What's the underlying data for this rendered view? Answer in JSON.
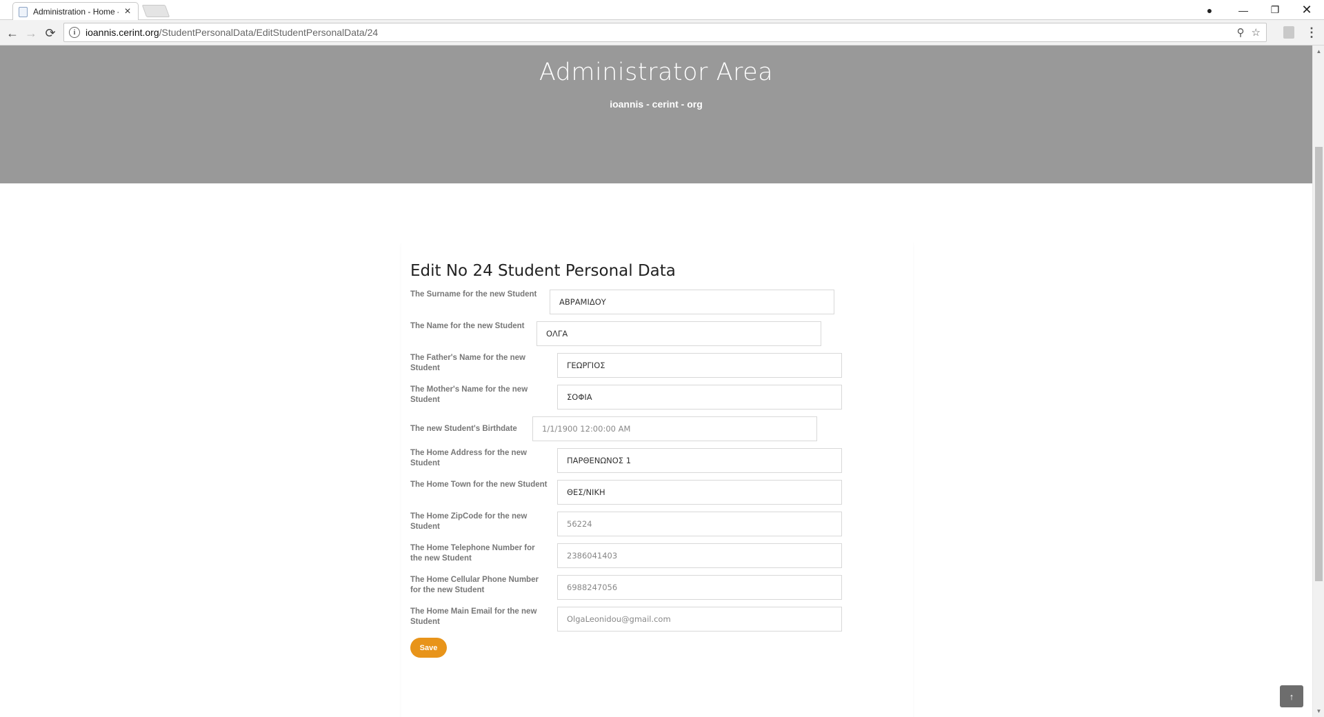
{
  "browser": {
    "tab_title": "Administration - Home -",
    "tab_close": "×",
    "url_host": "ioannis.cerint.org",
    "url_path": "/StudentPersonalData/EditStudentPersonalData/24",
    "info_icon": "i",
    "back_icon": "←",
    "forward_icon": "→",
    "reload_icon": "⟳",
    "zoom_icon": "⚲",
    "star_icon": "☆",
    "menu_icon": "⋮",
    "user_icon": "●",
    "minimize_icon": "—",
    "maximize_icon": "❐",
    "close_icon": "✕"
  },
  "hero": {
    "title": "Administrator Area",
    "subtitle": "ioannis - cerint - org",
    "background": "#999999"
  },
  "form": {
    "title": "Edit No 24 Student Personal Data",
    "fields": [
      {
        "label": "The Surname for the new Student",
        "value": "ΑΒΡΑΜΙΔΟΥ"
      },
      {
        "label": "The Name for the new Student",
        "value": "ΟΛΓΑ"
      },
      {
        "label": "The Father's Name for the new Student",
        "value": "ΓΕΩΡΓΙΟΣ"
      },
      {
        "label": "The Mother's Name for the new Student",
        "value": "ΣΟΦΙΑ"
      },
      {
        "label": "The new Student's Birthdate",
        "value": "1/1/1900 12:00:00 AM"
      },
      {
        "label": "The Home Address for the new Student",
        "value": "ΠΑΡΘΕΝΩΝΟΣ 1"
      },
      {
        "label": "The Home Town for the new Student",
        "value": "ΘΕΣ/ΝΙΚΗ"
      },
      {
        "label": "The Home ZipCode for the new Student",
        "value": "56224"
      },
      {
        "label": "The Home Telephone Number for the new Student",
        "value": "2386041403"
      },
      {
        "label": "The Home Cellular Phone Number for the new Student",
        "value": "6988247056"
      },
      {
        "label": "The Home Main Email for the new Student",
        "value": "OlgaLeonidou@gmail.com"
      }
    ],
    "save_label": "Save",
    "accent": "#e8941a"
  },
  "back_to_top_icon": "↑"
}
